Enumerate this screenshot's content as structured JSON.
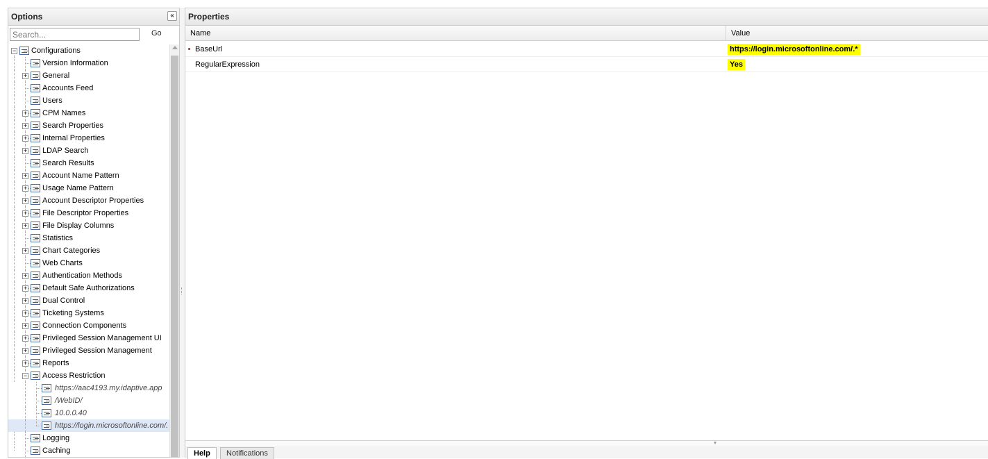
{
  "options_panel": {
    "title": "Options",
    "collapse_icon": "double-chevron-left-icon",
    "search": {
      "placeholder": "Search...",
      "value": ""
    },
    "go_label": "Go"
  },
  "tree": {
    "root": {
      "label": "Configurations",
      "expanded": true
    },
    "items": [
      {
        "label": "Version Information",
        "expandable": false
      },
      {
        "label": "General",
        "expandable": true
      },
      {
        "label": "Accounts Feed",
        "expandable": false
      },
      {
        "label": "Users",
        "expandable": false
      },
      {
        "label": "CPM Names",
        "expandable": true
      },
      {
        "label": "Search Properties",
        "expandable": true
      },
      {
        "label": "Internal Properties",
        "expandable": true
      },
      {
        "label": "LDAP Search",
        "expandable": true
      },
      {
        "label": "Search Results",
        "expandable": false
      },
      {
        "label": "Account Name Pattern",
        "expandable": true
      },
      {
        "label": "Usage Name Pattern",
        "expandable": true
      },
      {
        "label": "Account Descriptor Properties",
        "expandable": true
      },
      {
        "label": "File Descriptor Properties",
        "expandable": true
      },
      {
        "label": "File Display Columns",
        "expandable": true
      },
      {
        "label": "Statistics",
        "expandable": false
      },
      {
        "label": "Chart Categories",
        "expandable": true
      },
      {
        "label": "Web Charts",
        "expandable": false
      },
      {
        "label": "Authentication Methods",
        "expandable": true
      },
      {
        "label": "Default Safe Authorizations",
        "expandable": true
      },
      {
        "label": "Dual Control",
        "expandable": true
      },
      {
        "label": "Ticketing Systems",
        "expandable": true
      },
      {
        "label": "Connection Components",
        "expandable": true
      },
      {
        "label": "Privileged Session Management UI",
        "expandable": true
      },
      {
        "label": "Privileged Session Management",
        "expandable": true
      },
      {
        "label": "Reports",
        "expandable": true
      },
      {
        "label": "Access Restriction",
        "expandable": true,
        "expanded": true
      },
      {
        "label": "Logging",
        "expandable": false
      },
      {
        "label": "Caching",
        "expandable": false
      }
    ],
    "access_restriction_children": [
      {
        "label": "https://aac4193.my.idaptive.app",
        "selected": false
      },
      {
        "label": "/WebID/",
        "selected": false
      },
      {
        "label": "10.0.0.40",
        "selected": false
      },
      {
        "label": "https://login.microsoftonline.com/.",
        "selected": true
      }
    ]
  },
  "properties_panel": {
    "title": "Properties",
    "columns": {
      "name": "Name",
      "value": "Value"
    },
    "rows": [
      {
        "name": "BaseUrl",
        "value": "https://login.microsoftonline.com/.*",
        "required": true
      },
      {
        "name": "RegularExpression",
        "value": "Yes",
        "required": false
      }
    ],
    "highlight_color": "#ffff00"
  },
  "bottom_tabs": [
    {
      "label": "Help",
      "active": true
    },
    {
      "label": "Notifications",
      "active": false
    }
  ]
}
